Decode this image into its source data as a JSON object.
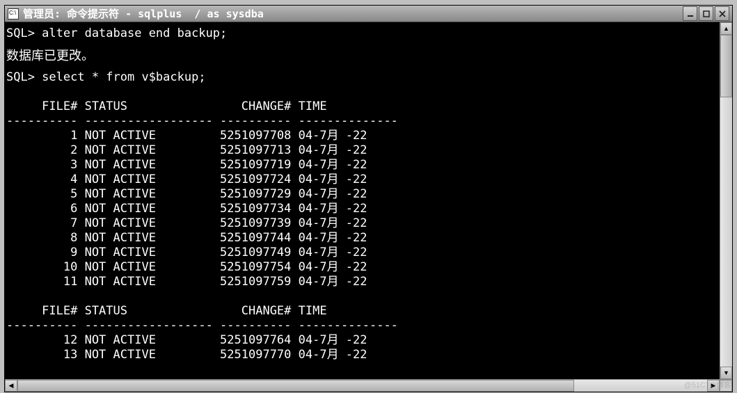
{
  "window": {
    "title": "管理员: 命令提示符 - sqlplus  / as sysdba"
  },
  "terminal": {
    "prompt": "SQL>",
    "command1": "alter database end backup;",
    "message": "数据库已更改。",
    "command2": "select * from v$backup;",
    "headers": {
      "file": "FILE#",
      "status": "STATUS",
      "change": "CHANGE#",
      "time": "TIME"
    },
    "separator": "---------- ------------------ ---------- --------------",
    "rows_block1": [
      {
        "file": "1",
        "status": "NOT ACTIVE",
        "change": "5251097708",
        "time": "04-7月 -22"
      },
      {
        "file": "2",
        "status": "NOT ACTIVE",
        "change": "5251097713",
        "time": "04-7月 -22"
      },
      {
        "file": "3",
        "status": "NOT ACTIVE",
        "change": "5251097719",
        "time": "04-7月 -22"
      },
      {
        "file": "4",
        "status": "NOT ACTIVE",
        "change": "5251097724",
        "time": "04-7月 -22"
      },
      {
        "file": "5",
        "status": "NOT ACTIVE",
        "change": "5251097729",
        "time": "04-7月 -22"
      },
      {
        "file": "6",
        "status": "NOT ACTIVE",
        "change": "5251097734",
        "time": "04-7月 -22"
      },
      {
        "file": "7",
        "status": "NOT ACTIVE",
        "change": "5251097739",
        "time": "04-7月 -22"
      },
      {
        "file": "8",
        "status": "NOT ACTIVE",
        "change": "5251097744",
        "time": "04-7月 -22"
      },
      {
        "file": "9",
        "status": "NOT ACTIVE",
        "change": "5251097749",
        "time": "04-7月 -22"
      },
      {
        "file": "10",
        "status": "NOT ACTIVE",
        "change": "5251097754",
        "time": "04-7月 -22"
      },
      {
        "file": "11",
        "status": "NOT ACTIVE",
        "change": "5251097759",
        "time": "04-7月 -22"
      }
    ],
    "rows_block2": [
      {
        "file": "12",
        "status": "NOT ACTIVE",
        "change": "5251097764",
        "time": "04-7月 -22"
      },
      {
        "file": "13",
        "status": "NOT ACTIVE",
        "change": "5251097770",
        "time": "04-7月 -22"
      }
    ]
  },
  "watermark": "@51CTO博客"
}
